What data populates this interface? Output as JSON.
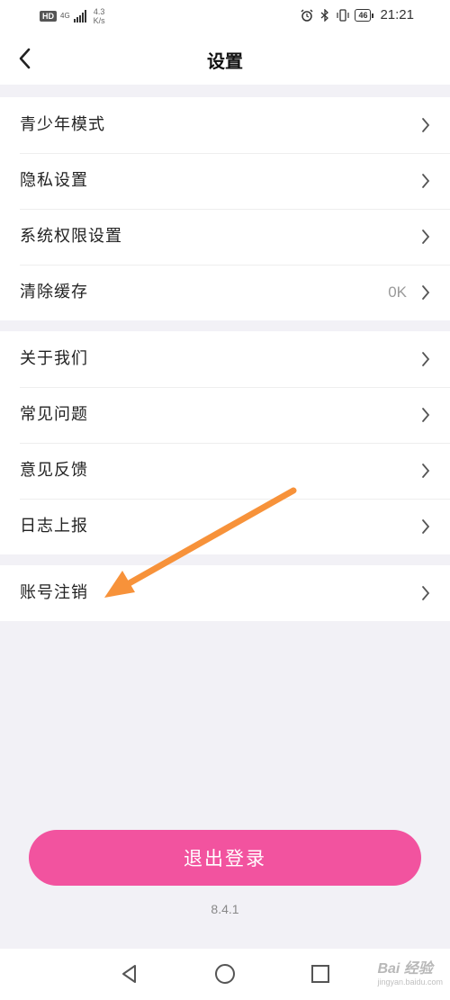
{
  "status_bar": {
    "hd": "HD",
    "net_type": "4G",
    "speed_value": "4.3",
    "speed_unit": "K/s",
    "battery": "46",
    "time": "21:21"
  },
  "header": {
    "title": "设置"
  },
  "groups": [
    {
      "items": [
        {
          "label": "青少年模式",
          "value": ""
        },
        {
          "label": "隐私设置",
          "value": ""
        },
        {
          "label": "系统权限设置",
          "value": ""
        },
        {
          "label": "清除缓存",
          "value": "0K"
        }
      ]
    },
    {
      "items": [
        {
          "label": "关于我们",
          "value": ""
        },
        {
          "label": "常见问题",
          "value": ""
        },
        {
          "label": "意见反馈",
          "value": ""
        },
        {
          "label": "日志上报",
          "value": ""
        }
      ]
    },
    {
      "items": [
        {
          "label": "账号注销",
          "value": ""
        }
      ]
    }
  ],
  "logout": {
    "label": "退出登录"
  },
  "version": "8.4.1",
  "watermark": {
    "brand": "Bai 经验",
    "sub": "jingyan.baidu.com"
  },
  "colors": {
    "accent": "#f2539f",
    "annotation_arrow": "#f7923a",
    "background": "#f2f1f6"
  }
}
